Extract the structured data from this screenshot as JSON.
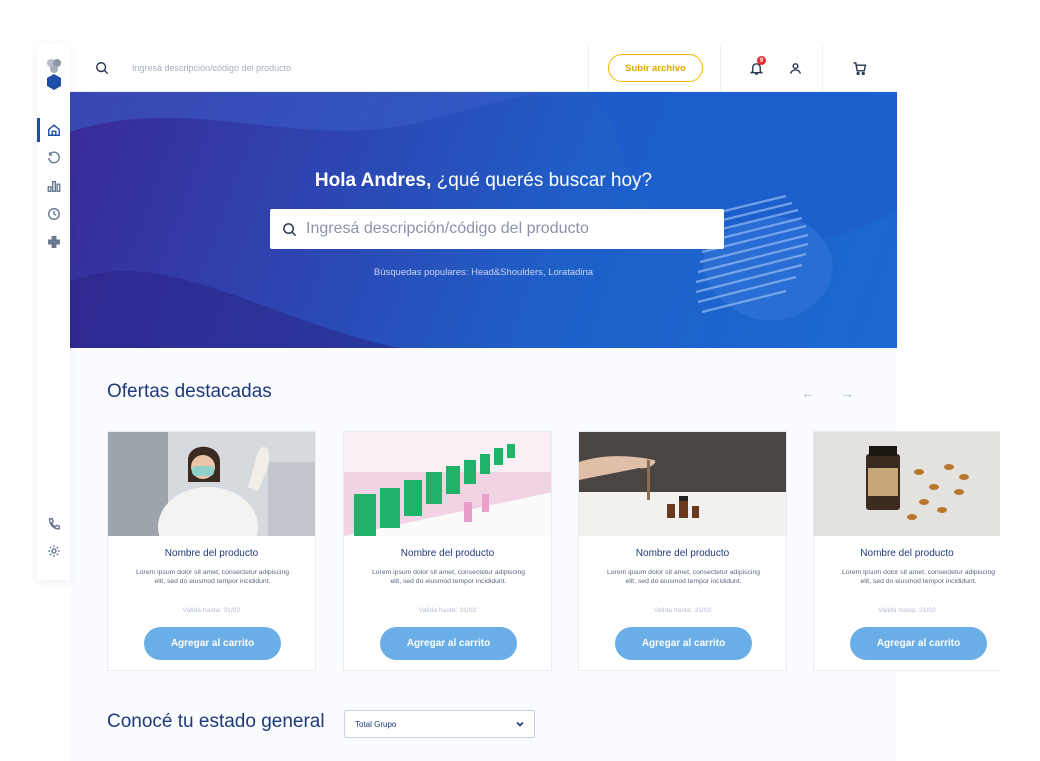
{
  "colors": {
    "brand_blue": "#1e4fa8",
    "accent_yellow": "#f5b800",
    "button_blue": "#6aaee8",
    "badge_red": "#e52d2d",
    "title_blue": "#1f3a7a"
  },
  "sidebar": {
    "items": [
      {
        "icon": "home-icon"
      },
      {
        "icon": "history-icon"
      },
      {
        "icon": "stats-icon"
      },
      {
        "icon": "clock-icon"
      },
      {
        "icon": "plus-cross-icon"
      }
    ],
    "bottom": [
      {
        "icon": "phone-icon"
      },
      {
        "icon": "settings-icon"
      }
    ]
  },
  "topbar": {
    "search_placeholder": "Ingresá descripción/código del producto",
    "upload_label": "Subir archivo",
    "notification_count": "9"
  },
  "hero": {
    "greeting_bold": "Hola Andres,",
    "greeting_rest": " ¿qué querés buscar hoy?",
    "search_placeholder": "Ingresá descripción/código del producto",
    "popular": "Búsquedas populares: Head&Shoulders, Loratadina"
  },
  "offers": {
    "title": "Ofertas destacadas",
    "prev_arrow": "←",
    "next_arrow": "→",
    "cards": [
      {
        "name": "Nombre del producto",
        "desc": "Lorem ipsum dolor sit amet, consectetur adipiscing elit, sed do eiusmod tempor incididunt.",
        "valid": "Valida hasta: 31/02",
        "button": "Agregar al carrito"
      },
      {
        "name": "Nombre del producto",
        "desc": "Lorem ipsum dolor sit amet, consectetur adipiscing elit, sed do eiusmod tempor incididunt.",
        "valid": "Valida hasta: 31/02",
        "button": "Agregar al carrito"
      },
      {
        "name": "Nombre del producto",
        "desc": "Lorem ipsum dolor sit amet, consectetur adipiscing elit, sed do eiusmod tempor incididunt.",
        "valid": "Valida hasta: 31/02",
        "button": "Agregar al carrito"
      },
      {
        "name": "Nombre del producto",
        "desc": "Lorem ipsum dolor sit amet, consectetur adipiscing elit, sed do eiusmod tempor incididunt.",
        "valid": "Valida hasta: 31/02",
        "button": "Agregar al carrito"
      }
    ]
  },
  "status": {
    "title": "Conocé tu estado general",
    "select_value": "Total Grupo"
  }
}
